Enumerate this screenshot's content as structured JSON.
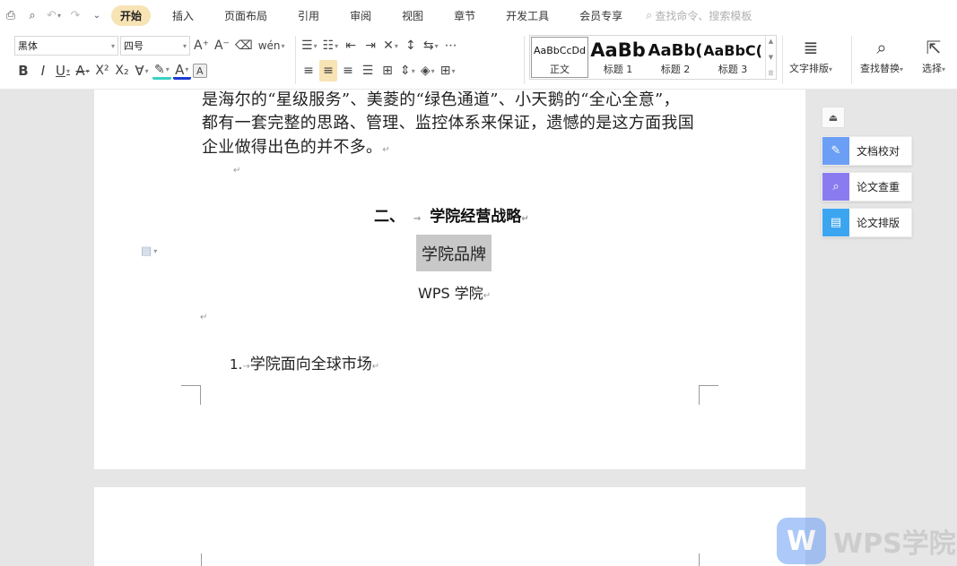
{
  "tabs": {
    "items": [
      "开始",
      "插入",
      "页面布局",
      "引用",
      "审阅",
      "视图",
      "章节",
      "开发工具",
      "会员专享"
    ],
    "search_placeholder": "查找命令、搜索模板"
  },
  "ribbon": {
    "font_family": "黑体",
    "font_size": "四号",
    "styles": [
      {
        "preview": "AaBbCcDd",
        "label": "正文"
      },
      {
        "preview": "AaBb",
        "label": "标题 1"
      },
      {
        "preview": "AaBb(",
        "label": "标题 2"
      },
      {
        "preview": "AaBbC(",
        "label": "标题 3"
      }
    ],
    "text_layout_label": "文字排版",
    "find_replace_label": "查找替换",
    "select_label": "选择"
  },
  "document": {
    "lines": [
      "是海尔的“星级服务”、美菱的“绿色通道”、小天鹅的“全心全意”，",
      "都有一套完整的思路、管理、监控体系来保证，遗憾的是这方面我国",
      "企业做得出色的并不多。"
    ],
    "heading_num": "二、",
    "heading_text": "学院经营战略",
    "selected_text": "学院品牌",
    "body_text": "WPS 学院",
    "list_number": "1.",
    "list_text": "学院面向全球市场",
    "paragraph_mark": "↵"
  },
  "sidebar": {
    "buttons": [
      {
        "label": "文档校对",
        "color": "#6b9ef5"
      },
      {
        "label": "论文查重",
        "color": "#8a7cf0"
      },
      {
        "label": "论文排版",
        "color": "#3ca5f0"
      }
    ]
  },
  "watermark": {
    "text": "WPS学院"
  },
  "colors": {
    "active_tab": "#f7e3b4",
    "selection": "#c8c8c8",
    "highlight_color": "#3ad1c1",
    "font_color": "#1a3ad6"
  }
}
